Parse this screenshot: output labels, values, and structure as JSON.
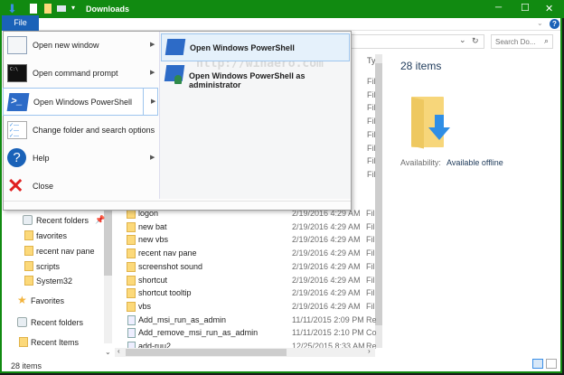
{
  "window": {
    "title": "Downloads",
    "minimize": "─",
    "maximize": "☐",
    "close": "✕"
  },
  "ribbon": {
    "file_tab": "File",
    "help_icon": "?"
  },
  "address": {
    "search_placeholder": "Search Do...",
    "refresh": "↻",
    "dropdown": "⌄"
  },
  "file_menu": {
    "items": [
      {
        "label": "Open new window",
        "icon": "window-icon",
        "submenu": true
      },
      {
        "label": "Open command prompt",
        "icon": "cmd-icon",
        "submenu": true
      },
      {
        "label": "Open Windows PowerShell",
        "icon": "powershell-icon",
        "submenu": true
      },
      {
        "label": "Change folder and search options",
        "icon": "options-icon",
        "submenu": false
      },
      {
        "label": "Help",
        "icon": "help-icon",
        "submenu": true
      },
      {
        "label": "Close",
        "icon": "close-x-icon",
        "submenu": false
      }
    ],
    "submenu": [
      "Open Windows PowerShell",
      "Open Windows PowerShell as administrator"
    ],
    "watermark": "http://winaero.com"
  },
  "nav_pane": {
    "items": [
      "Recent folders",
      "favorites",
      "recent nav pane",
      "scripts",
      "System32",
      "Favorites",
      "Recent folders",
      "Recent Items"
    ]
  },
  "files": {
    "type_header": "Ty",
    "rows": [
      {
        "name": "logon",
        "date": "2/19/2016 4:29 AM",
        "type": "Fil"
      },
      {
        "name": "new bat",
        "date": "2/19/2016 4:29 AM",
        "type": "Fil"
      },
      {
        "name": "new vbs",
        "date": "2/19/2016 4:29 AM",
        "type": "Fil"
      },
      {
        "name": "recent nav pane",
        "date": "2/19/2016 4:29 AM",
        "type": "Fil"
      },
      {
        "name": "screenshot sound",
        "date": "2/19/2016 4:29 AM",
        "type": "Fil"
      },
      {
        "name": "shortcut",
        "date": "2/19/2016 4:29 AM",
        "type": "Fil"
      },
      {
        "name": "shortcut tooltip",
        "date": "2/19/2016 4:29 AM",
        "type": "Fil"
      },
      {
        "name": "vbs",
        "date": "2/19/2016 4:29 AM",
        "type": "Fil"
      },
      {
        "name": "Add_msi_run_as_admin",
        "date": "11/11/2015 2:09 PM",
        "type": "Re"
      },
      {
        "name": "Add_remove_msi_run_as_admin",
        "date": "11/11/2015 2:10 PM",
        "type": "Co"
      },
      {
        "name": "add-ruu2",
        "date": "12/25/2015 8:33 AM",
        "type": "Re"
      }
    ],
    "hidden_type_rows": [
      "Fil",
      "Fil",
      "Fil",
      "Fil",
      "Fil",
      "Fil",
      "Fil",
      "Fil"
    ]
  },
  "details": {
    "count": "28 items",
    "availability_label": "Availability:",
    "availability_value": "Available offline"
  },
  "status": {
    "count": "28 items"
  },
  "colors": {
    "titlebar": "#118a11",
    "file_tab": "#1a62b8",
    "accent": "#2d6bc7"
  }
}
